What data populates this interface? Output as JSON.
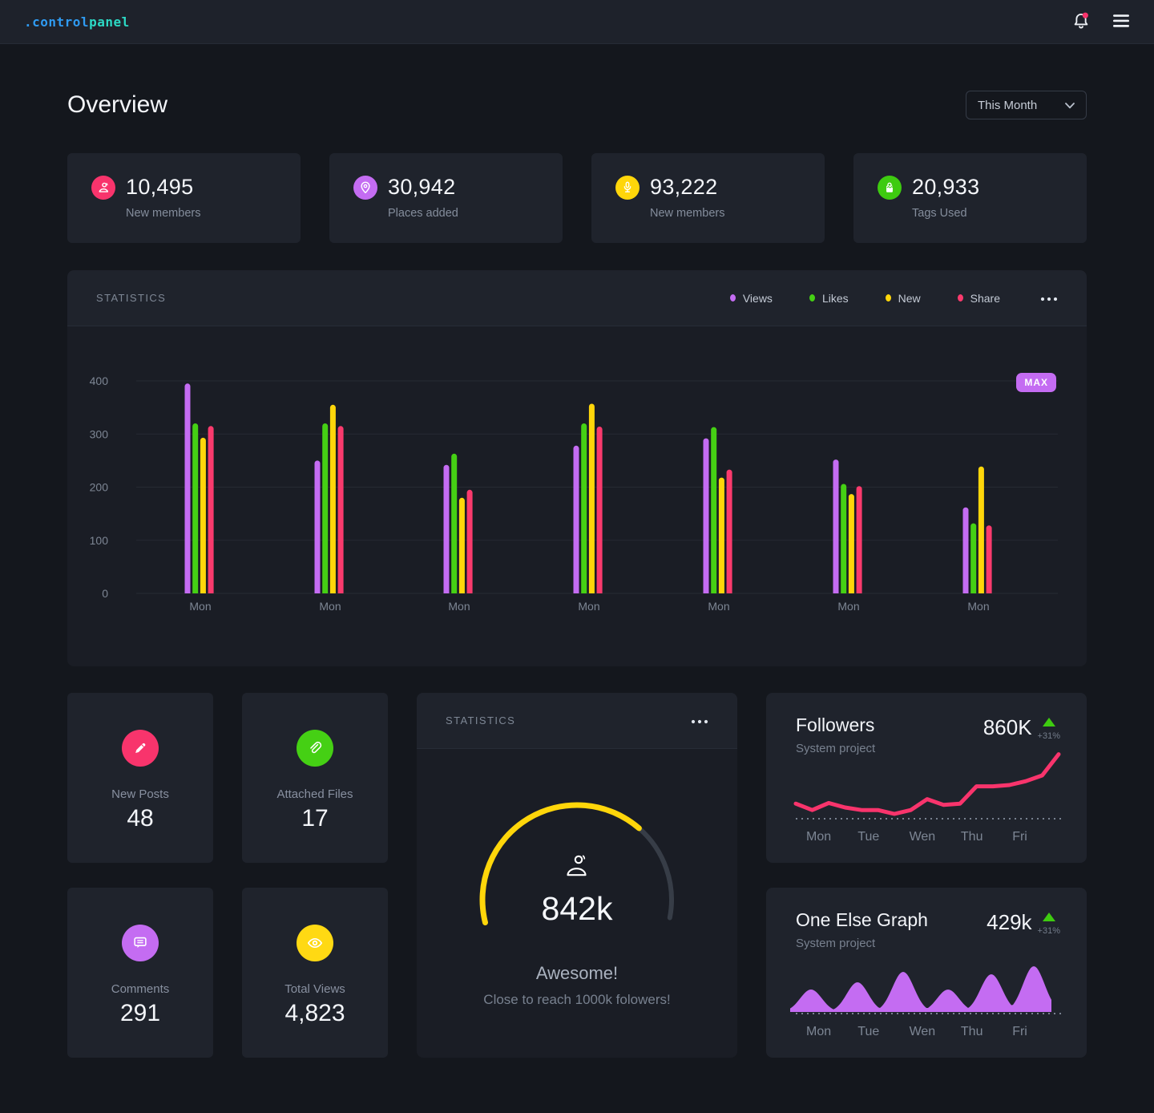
{
  "navbar": {
    "logo_prefix": ".control",
    "logo_suffix": "panel",
    "bell_icon": "bell-icon",
    "menu_icon": "hamburger-menu-icon"
  },
  "page": {
    "title": "Overview",
    "period": "This Month"
  },
  "stat_cards": [
    {
      "value": "10,495",
      "label": "New members",
      "icon": "person-icon",
      "color": "#f8346c"
    },
    {
      "value": "30,942",
      "label": "Places added",
      "icon": "location-pin-icon",
      "color": "#c46cf2"
    },
    {
      "value": "93,222",
      "label": "New members",
      "icon": "microphone-icon",
      "color": "#ffd60a"
    },
    {
      "value": "20,933",
      "label": "Tags Used",
      "icon": "tag-icon",
      "color": "#3ecb10"
    }
  ],
  "statistics_card": {
    "title": "STATISTICS",
    "menu_icon": "ellipsis-icon",
    "max_badge": "MAX",
    "legend": [
      {
        "label": "Views",
        "color": "#c46cf2"
      },
      {
        "label": "Likes",
        "color": "#45d014"
      },
      {
        "label": "New",
        "color": "#ffd60a"
      },
      {
        "label": "Share",
        "color": "#fa3a6d"
      }
    ],
    "chart_data": {
      "type": "bar",
      "categories": [
        "Mon",
        "Mon",
        "Mon",
        "Mon",
        "Mon",
        "Mon",
        "Mon"
      ],
      "series": [
        {
          "name": "Views",
          "color": "#c46cf2",
          "values": [
            395,
            250,
            242,
            278,
            292,
            252,
            162
          ]
        },
        {
          "name": "Likes",
          "color": "#45d014",
          "values": [
            320,
            320,
            263,
            320,
            313,
            206,
            132
          ]
        },
        {
          "name": "New",
          "color": "#ffd60a",
          "values": [
            293,
            355,
            180,
            357,
            218,
            187,
            239
          ]
        },
        {
          "name": "Share",
          "color": "#fa3a6d",
          "values": [
            315,
            315,
            195,
            314,
            233,
            202,
            128
          ]
        }
      ],
      "ylim": [
        0,
        400
      ],
      "yticks": [
        0,
        100,
        200,
        300,
        400
      ],
      "annotation": "MAX",
      "grid": true,
      "legend_position": "top-right"
    }
  },
  "mini_cards": [
    {
      "label": "New Posts",
      "value": "48",
      "icon": "pencil-icon",
      "color": "#f8346c"
    },
    {
      "label": "Attached Files",
      "value": "17",
      "icon": "paperclip-icon",
      "color": "#45d014"
    },
    {
      "label": "Comments",
      "value": "291",
      "icon": "comment-icon",
      "color": "#c46cf2"
    },
    {
      "label": "Total Views",
      "value": "4,823",
      "icon": "eye-icon",
      "color": "#ffd913"
    }
  ],
  "gauge_card": {
    "title": "STATISTICS",
    "menu_icon": "ellipsis-icon",
    "center_icon": "person-icon",
    "value": "842k",
    "message": "Awesome!",
    "submessage": "Close to reach 1000k folowers!",
    "chart_data": {
      "type": "gauge",
      "value": 842,
      "max": 1000,
      "display": "842k",
      "color": "#ffd60a",
      "track_color": "#373d47"
    }
  },
  "followers_card": {
    "title": "Followers",
    "subtitle": "System project",
    "value": "860K",
    "change": "+31%",
    "change_icon": "triangle-up-icon",
    "chart_data": {
      "type": "line",
      "color": "#f8346c",
      "baseline": "dotted",
      "x_labels": [
        "Mon",
        "Tue",
        "Wen",
        "Thu",
        "Fri"
      ],
      "values": [
        21,
        11,
        22,
        15,
        11,
        11,
        5,
        11,
        28,
        19,
        21,
        48,
        48,
        50,
        56,
        65,
        98
      ],
      "ylim": [
        0,
        100
      ]
    }
  },
  "one_else_card": {
    "title": "One Else Graph",
    "subtitle": "System project",
    "value": "429k",
    "change": "+31%",
    "change_icon": "triangle-up-icon",
    "chart_data": {
      "type": "area",
      "color": "#c46cf2",
      "baseline": "dotted",
      "x_labels": [
        "Mon",
        "Tue",
        "Wen",
        "Thu",
        "Fri"
      ],
      "bump_heights": [
        28,
        37,
        50,
        28,
        47,
        57
      ]
    }
  }
}
